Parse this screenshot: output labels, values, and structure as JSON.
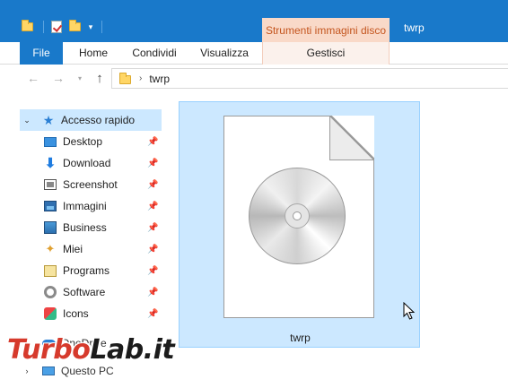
{
  "window": {
    "title": "twrp",
    "context_tab_header": "Strumenti immagini disco",
    "quick_access_toolbar": [
      "folder-icon",
      "properties-icon",
      "new-folder-icon",
      "customize-dropdown"
    ]
  },
  "ribbon": {
    "tabs": [
      {
        "id": "file",
        "label": "File"
      },
      {
        "id": "home",
        "label": "Home"
      },
      {
        "id": "share",
        "label": "Condividi"
      },
      {
        "id": "view",
        "label": "Visualizza"
      },
      {
        "id": "manage",
        "label": "Gestisci"
      }
    ],
    "colors": {
      "accent": "#1979ca",
      "context": "#f9d9c8",
      "context_text": "#c4551e"
    }
  },
  "address_bar": {
    "path": [
      "twrp"
    ]
  },
  "sidebar": {
    "items": [
      {
        "label": "Accesso rapido",
        "icon": "star-icon",
        "level": 0,
        "expanded": true,
        "selected": true
      },
      {
        "label": "Desktop",
        "icon": "desktop-icon",
        "level": 1,
        "pinned": true
      },
      {
        "label": "Download",
        "icon": "download-icon",
        "level": 1,
        "pinned": true
      },
      {
        "label": "Screenshot",
        "icon": "screenshot-folder-icon",
        "level": 1,
        "pinned": true
      },
      {
        "label": "Immagini",
        "icon": "pictures-icon",
        "level": 1,
        "pinned": true
      },
      {
        "label": "Business",
        "icon": "business-folder-icon",
        "level": 1,
        "pinned": true
      },
      {
        "label": "Miei",
        "icon": "miei-folder-icon",
        "level": 1,
        "pinned": true
      },
      {
        "label": "Programs",
        "icon": "programs-folder-icon",
        "level": 1,
        "pinned": true
      },
      {
        "label": "Software",
        "icon": "software-folder-icon",
        "level": 1,
        "pinned": true
      },
      {
        "label": "Icons",
        "icon": "icons-folder-icon",
        "level": 1,
        "pinned": true
      },
      {
        "label": "OneDrive",
        "icon": "onedrive-icon",
        "level": 0,
        "expanded": false
      },
      {
        "label": "Questo PC",
        "icon": "this-pc-icon",
        "level": 0,
        "expanded": false
      }
    ]
  },
  "content": {
    "items": [
      {
        "name": "twrp",
        "type": "disc-image",
        "icon": "disc-image-file-icon",
        "selected": true
      }
    ]
  },
  "watermark": {
    "text_a": "Turbo",
    "text_b": "Lab.it"
  }
}
